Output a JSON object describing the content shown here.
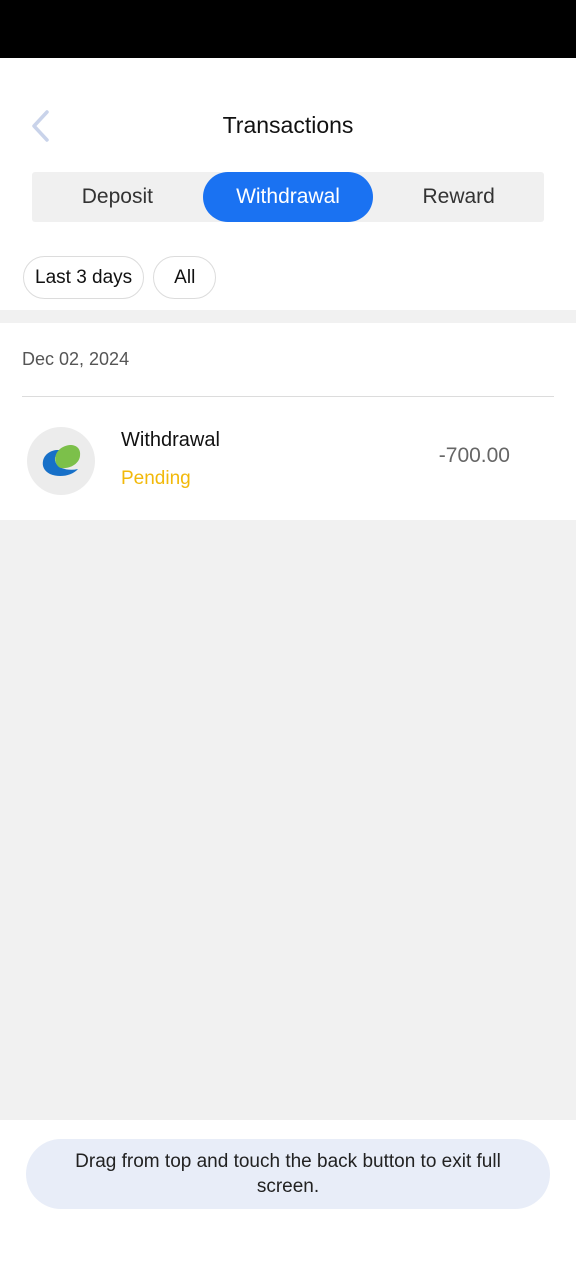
{
  "header": {
    "title": "Transactions",
    "back_icon": "chevron-left-icon"
  },
  "tabs": [
    {
      "label": "Deposit",
      "active": false
    },
    {
      "label": "Withdrawal",
      "active": true
    },
    {
      "label": "Reward",
      "active": false
    }
  ],
  "filters": [
    {
      "label": "Last 3 days"
    },
    {
      "label": "All"
    }
  ],
  "transactions": {
    "date": "Dec 02, 2024",
    "items": [
      {
        "title": "Withdrawal",
        "status": "Pending",
        "amount": "-700.00",
        "icon": "leaf-logo-icon"
      }
    ]
  },
  "toast": {
    "text": "Drag from top and touch the back button to exit full screen."
  },
  "colors": {
    "accent": "#1a72f2",
    "pending": "#f2b90a",
    "background": "#f1f1f1"
  }
}
